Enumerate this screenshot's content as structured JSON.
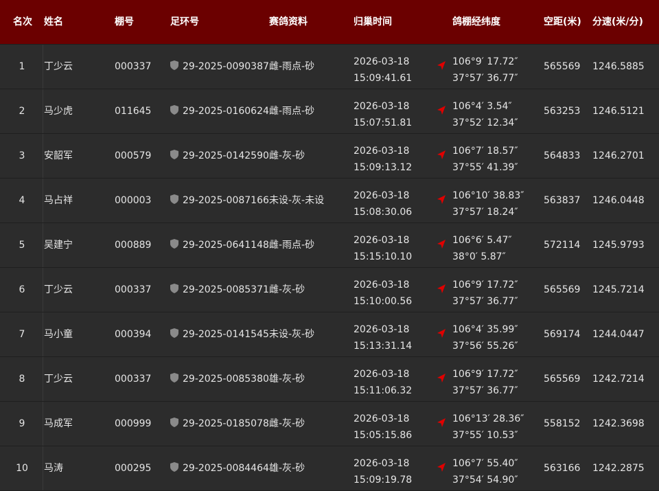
{
  "header": {
    "rank": "名次",
    "name": "姓名",
    "coop": "棚号",
    "ring": "足环号",
    "info": "赛鸽资料",
    "time": "归巢时间",
    "coord": "鸽棚经纬度",
    "dist": "空距(米)",
    "speed": "分速(米/分)"
  },
  "colors": {
    "header_bg": "#6b0000",
    "row_bg": "#2c2c2c",
    "arrow": "#e00000"
  },
  "icons": {
    "ring": "shield-icon",
    "coord": "location-arrow-icon"
  },
  "rows": [
    {
      "rank": "1",
      "name": "丁少云",
      "coop": "000337",
      "ring": "29-2025-0090387",
      "info": "雌-雨点-砂",
      "date": "2026-03-18",
      "time": "15:09:41.61",
      "lon": "106°9′ 17.72″",
      "lat": "37°57′ 36.77″",
      "dist": "565569",
      "speed": "1246.5885"
    },
    {
      "rank": "2",
      "name": "马少虎",
      "coop": "011645",
      "ring": "29-2025-0160624",
      "info": "雌-雨点-砂",
      "date": "2026-03-18",
      "time": "15:07:51.81",
      "lon": "106°4′ 3.54″",
      "lat": "37°52′ 12.34″",
      "dist": "563253",
      "speed": "1246.5121"
    },
    {
      "rank": "3",
      "name": "安韶军",
      "coop": "000579",
      "ring": "29-2025-0142590",
      "info": "雌-灰-砂",
      "date": "2026-03-18",
      "time": "15:09:13.12",
      "lon": "106°7′ 18.57″",
      "lat": "37°55′ 41.39″",
      "dist": "564833",
      "speed": "1246.2701"
    },
    {
      "rank": "4",
      "name": "马占祥",
      "coop": "000003",
      "ring": "29-2025-0087166",
      "info": "未设-灰-未设",
      "date": "2026-03-18",
      "time": "15:08:30.06",
      "lon": "106°10′ 38.83″",
      "lat": "37°57′ 18.24″",
      "dist": "563837",
      "speed": "1246.0448"
    },
    {
      "rank": "5",
      "name": "吴建宁",
      "coop": "000889",
      "ring": "29-2025-0641148",
      "info": "雌-雨点-砂",
      "date": "2026-03-18",
      "time": "15:15:10.10",
      "lon": "106°6′ 5.47″",
      "lat": "38°0′ 5.87″",
      "dist": "572114",
      "speed": "1245.9793"
    },
    {
      "rank": "6",
      "name": "丁少云",
      "coop": "000337",
      "ring": "29-2025-0085371",
      "info": "雌-灰-砂",
      "date": "2026-03-18",
      "time": "15:10:00.56",
      "lon": "106°9′ 17.72″",
      "lat": "37°57′ 36.77″",
      "dist": "565569",
      "speed": "1245.7214"
    },
    {
      "rank": "7",
      "name": "马小童",
      "coop": "000394",
      "ring": "29-2025-0141545",
      "info": "未设-灰-砂",
      "date": "2026-03-18",
      "time": "15:13:31.14",
      "lon": "106°4′ 35.99″",
      "lat": "37°56′ 55.26″",
      "dist": "569174",
      "speed": "1244.0447"
    },
    {
      "rank": "8",
      "name": "丁少云",
      "coop": "000337",
      "ring": "29-2025-0085380",
      "info": "雄-灰-砂",
      "date": "2026-03-18",
      "time": "15:11:06.32",
      "lon": "106°9′ 17.72″",
      "lat": "37°57′ 36.77″",
      "dist": "565569",
      "speed": "1242.7214"
    },
    {
      "rank": "9",
      "name": "马成军",
      "coop": "000999",
      "ring": "29-2025-0185078",
      "info": "雌-灰-砂",
      "date": "2026-03-18",
      "time": "15:05:15.86",
      "lon": "106°13′ 28.36″",
      "lat": "37°55′ 10.53″",
      "dist": "558152",
      "speed": "1242.3698"
    },
    {
      "rank": "10",
      "name": "马涛",
      "coop": "000295",
      "ring": "29-2025-0084464",
      "info": "雄-灰-砂",
      "date": "2026-03-18",
      "time": "15:09:19.78",
      "lon": "106°7′ 55.40″",
      "lat": "37°54′ 54.90″",
      "dist": "563166",
      "speed": "1242.2875"
    }
  ]
}
